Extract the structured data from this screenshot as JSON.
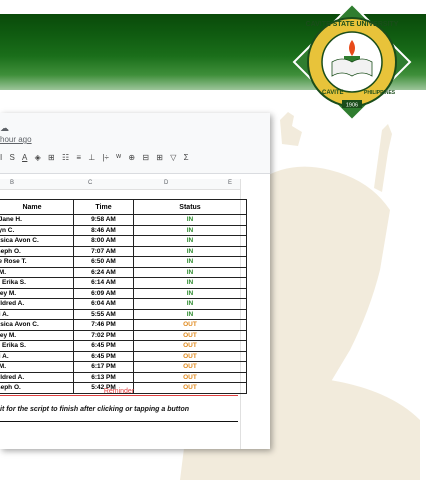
{
  "sheet": {
    "last_edit": "hour ago",
    "cloud_icon": "cloud-icon",
    "toolbar": [
      "I",
      "S",
      "A",
      "◈",
      "⊞",
      "☷",
      "≡",
      "⊥",
      "|÷",
      "ᵂ",
      "⊕",
      "⊟",
      "⊞",
      "▽",
      "Σ"
    ],
    "col_headers": {
      "b": "B",
      "c": "C",
      "d": "D",
      "e": "E"
    }
  },
  "table": {
    "headers": {
      "name": "Name",
      "time": "Time",
      "status": "Status"
    },
    "rows": [
      {
        "name": "h Jane H.",
        "time": "9:58 AM",
        "status": "IN"
      },
      {
        "name": "elyn C.",
        "time": "8:46 AM",
        "status": "IN"
      },
      {
        "name": "essica Avon C.",
        "time": "8:00 AM",
        "status": "IN"
      },
      {
        "name": "oseph O.",
        "time": "7:07 AM",
        "status": "IN"
      },
      {
        "name": "kie Rose T.",
        "time": "6:50 AM",
        "status": "IN"
      },
      {
        "name": "h M.",
        "time": "6:24 AM",
        "status": "IN"
      },
      {
        "name": "ce Erika S.",
        "time": "6:14 AM",
        "status": "IN"
      },
      {
        "name": "ffrey M.",
        "time": "6:09 AM",
        "status": "IN"
      },
      {
        "name": "Mildred A.",
        "time": "6:04 AM",
        "status": "IN"
      },
      {
        "name": "mi A.",
        "time": "5:55 AM",
        "status": "IN"
      },
      {
        "name": "essica Avon C.",
        "time": "7:46 PM",
        "status": "OUT"
      },
      {
        "name": "ffrey M.",
        "time": "7:02 PM",
        "status": "OUT"
      },
      {
        "name": "ce Erika S.",
        "time": "6:45 PM",
        "status": "OUT"
      },
      {
        "name": "mi A.",
        "time": "6:45 PM",
        "status": "OUT"
      },
      {
        "name": "h M.",
        "time": "6:17 PM",
        "status": "OUT"
      },
      {
        "name": "Mildred A.",
        "time": "6:13 PM",
        "status": "OUT"
      },
      {
        "name": "oseph O.",
        "time": "5:42 PM",
        "status": "OUT"
      }
    ]
  },
  "reminder": "Reminder",
  "notice": "it for the script to finish after clicking or tapping a button",
  "seal": {
    "ring_text": "CAVITE STATE UNIVERSITY",
    "bottom_text": "CAVITE",
    "right_text": "PHILIPPINES",
    "year": "1906"
  },
  "colors": {
    "banner": "#0f5a10",
    "in": "#2e8b2e",
    "out": "#e08a1e",
    "reminder": "#e04040"
  }
}
